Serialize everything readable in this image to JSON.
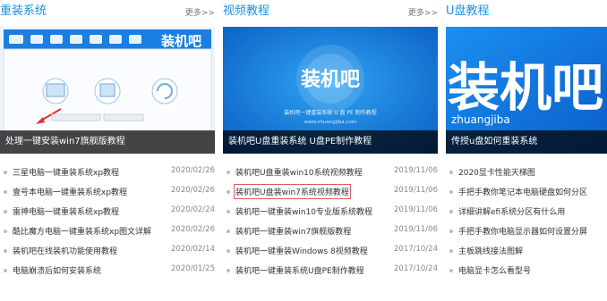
{
  "columns": [
    {
      "title": "重装系统",
      "more": "更多>>",
      "card": {
        "caption": "处理一键安装win7旗舰版教程",
        "screenshot_logo": "装机吧"
      },
      "items": [
        {
          "text": "三星电脑一键重装系统xp教程",
          "date": "2020/02/26"
        },
        {
          "text": "壹号本电脑一键重装系统xp教程",
          "date": "2020/02/26"
        },
        {
          "text": "雷神电脑一键重装系统xp教程",
          "date": "2020/02/24"
        },
        {
          "text": "酷比魔方电脑一键重装系统xp图文详解",
          "date": "2020/02/26"
        },
        {
          "text": "装机吧在线装机功能使用教程",
          "date": "2020/02/14"
        },
        {
          "text": "电脑崩溃后如何安装系统",
          "date": "2020/01/25"
        }
      ]
    },
    {
      "title": "视频教程",
      "more": "更多>>",
      "card": {
        "caption": "装机吧U盘重装系统 U盘PE制作教程",
        "logo": "装机吧",
        "subtitle": "装机吧一键重装系统 U 盘 PE 制作教程",
        "url": "www.zhuangjiba.com"
      },
      "items": [
        {
          "text": "装机吧U盘重装win10系统视频教程",
          "date": "2019/11/06"
        },
        {
          "text": "装机吧U盘装win7系统视频教程",
          "date": "2019/11/06"
        },
        {
          "text": "装机吧一键重装win10专业版系统教程",
          "date": "2019/11/06"
        },
        {
          "text": "装机吧一键重装win7旗舰版教程",
          "date": "2019/11/06"
        },
        {
          "text": "装机吧一键重装Windows 8视频教程",
          "date": "2017/10/24"
        },
        {
          "text": "装机吧一键重装系统U盘PE制作教程",
          "date": "2017/10/24"
        }
      ]
    },
    {
      "title": "U盘教程",
      "card": {
        "caption": "传授u盘如何重装系统",
        "logo": "装机吧",
        "url_text": "zhuangjiba"
      },
      "items": [
        {
          "text": "2020显卡性能天梯图"
        },
        {
          "text": "手把手教你笔记本电脑硬盘如何分区"
        },
        {
          "text": "详细讲解efi系统分区有什么用"
        },
        {
          "text": "手把手教你电脑显示器如何设置分屏"
        },
        {
          "text": "主板跳线接法图解"
        },
        {
          "text": "电脑显卡怎么看型号"
        }
      ]
    }
  ],
  "colors": {
    "accent": "#1e8fe0",
    "highlight_border": "#e15a5a",
    "caption_bg": "#000000"
  }
}
